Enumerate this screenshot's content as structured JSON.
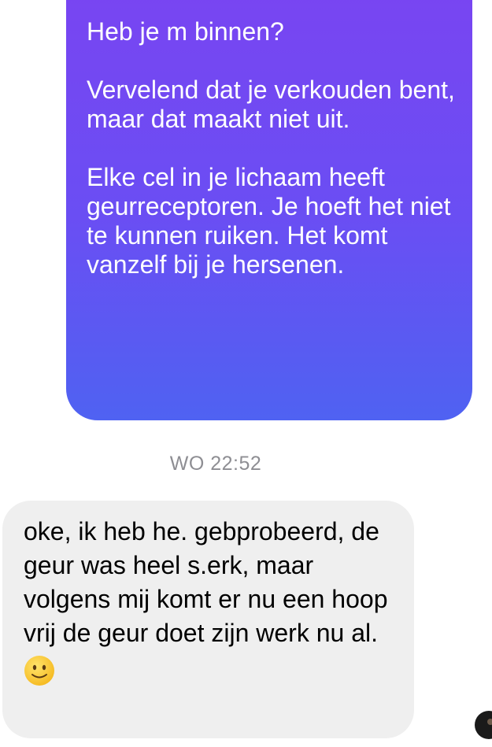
{
  "conversation": {
    "outgoing": {
      "paragraphs": [
        "Heb je m binnen?",
        "Vervelend dat je verkouden bent, maar dat maakt niet uit.",
        "Elke cel in je lichaam heeft geurreceptoren. Je hoeft het niet te kunnen ruiken. Het komt vanzelf bij je hersenen."
      ]
    },
    "timestamp": "WO 22:52",
    "incoming": {
      "text": "oke, ik heb he. gebprobeerd, de geur was heel s.erk, maar volgens mij komt er nu een hoop vrij de geur doet zijn werk nu al.",
      "emoji": "slightly-smiling-face-icon"
    }
  },
  "colors": {
    "outgoing_gradient_top": "#7a44f2",
    "outgoing_gradient_bottom": "#4f62f2",
    "incoming_bubble": "#efefef",
    "timestamp": "#8e8e93"
  }
}
